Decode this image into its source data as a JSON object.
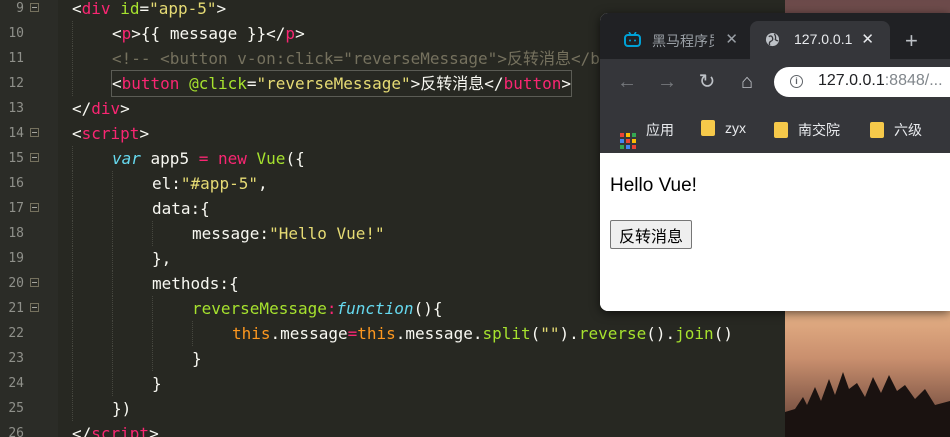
{
  "editor": {
    "lines": [
      {
        "n": "9",
        "fold": true,
        "html": "[{\"c\":\"p\",\"t\":\"<\"},{\"c\":\"t\",\"t\":\"div\"},{\"c\":\"p\",\"t\":\" \"},{\"c\":\"a\",\"t\":\"id\"},{\"c\":\"p\",\"t\":\"=\"},{\"c\":\"s\",\"t\":\"\\\"app-5\\\"\"},{\"c\":\"p\",\"t\":\">\"}]",
        "indent": 0
      },
      {
        "n": "10",
        "fold": false,
        "indent": 1
      },
      {
        "n": "11",
        "fold": false,
        "indent": 1
      },
      {
        "n": "12",
        "fold": false,
        "indent": 1
      },
      {
        "n": "13",
        "fold": false,
        "indent": 0
      },
      {
        "n": "14",
        "fold": true,
        "indent": 0
      },
      {
        "n": "15",
        "fold": true,
        "indent": 1
      },
      {
        "n": "16",
        "fold": false,
        "indent": 2
      },
      {
        "n": "17",
        "fold": true,
        "indent": 2
      },
      {
        "n": "18",
        "fold": false,
        "indent": 3
      },
      {
        "n": "19",
        "fold": false,
        "indent": 2
      },
      {
        "n": "20",
        "fold": true,
        "indent": 2
      },
      {
        "n": "21",
        "fold": true,
        "indent": 3
      },
      {
        "n": "22",
        "fold": false,
        "indent": 4
      },
      {
        "n": "23",
        "fold": false,
        "indent": 3
      },
      {
        "n": "24",
        "fold": false,
        "indent": 2
      },
      {
        "n": "25",
        "fold": false,
        "indent": 1
      },
      {
        "n": "26",
        "fold": false,
        "indent": 0
      }
    ],
    "tokens": {
      "l9": [
        "<",
        "div",
        " ",
        "id",
        "=",
        "\"app-5\"",
        ">"
      ],
      "l10": [
        "<",
        "p",
        ">",
        "{{ message }}",
        "</",
        "p",
        ">"
      ],
      "l11": [
        "<!-- <button v-on:click=\"reverseMessage\">反转消息</b"
      ],
      "l12": [
        "<",
        "button",
        " ",
        "@click",
        "=",
        "\"reverseMessage\"",
        ">",
        "反转消息",
        "</",
        "button",
        ">"
      ],
      "l13": [
        "</",
        "div",
        ">"
      ],
      "l14": [
        "<",
        "script",
        ">"
      ],
      "l15": [
        "var",
        " app5 ",
        "=",
        " ",
        "new",
        " ",
        "Vue",
        "({"
      ],
      "l16": [
        "el:",
        "\"#app-5\"",
        ","
      ],
      "l17": [
        "data:{"
      ],
      "l18": [
        "message:",
        "\"Hello Vue!\""
      ],
      "l19": [
        "},"
      ],
      "l20": [
        "methods:{"
      ],
      "l21": [
        "reverseMessage",
        ":",
        "function",
        "(){"
      ],
      "l22": [
        "this",
        ".message",
        "=",
        "this",
        ".message.",
        "split",
        "(",
        "\"\"",
        ").",
        "reverse",
        "().",
        "join",
        "()"
      ],
      "l23": [
        "}"
      ],
      "l24": [
        "}"
      ],
      "l25": [
        "})"
      ],
      "l26": [
        "</",
        "script",
        ">"
      ]
    }
  },
  "browser": {
    "tabs": [
      {
        "title": "黑马程序员",
        "close": "✕",
        "active": false
      },
      {
        "title": "127.0.0.1",
        "close": "✕",
        "active": true
      }
    ],
    "new_tab": "+",
    "nav": {
      "back": "←",
      "forward": "→",
      "reload": "↻",
      "home": "⌂"
    },
    "url": {
      "host": "127.0.0.1",
      "port": ":8848/..."
    },
    "bookmarks": [
      {
        "label": "应用",
        "icon": "apps-grid-icon"
      },
      {
        "label": "zyx",
        "icon": "folder-icon"
      },
      {
        "label": "南交院",
        "icon": "folder-icon"
      },
      {
        "label": "六级",
        "icon": "folder-icon"
      }
    ],
    "page": {
      "message": "Hello Vue!",
      "button": "反转消息"
    }
  },
  "colors": {
    "editor_bg": "#272822",
    "tag": "#f92672",
    "attr": "#a6e22e",
    "string": "#e6db74",
    "comment": "#75715e",
    "keyword": "#66d9ef",
    "this": "#fd971f"
  }
}
